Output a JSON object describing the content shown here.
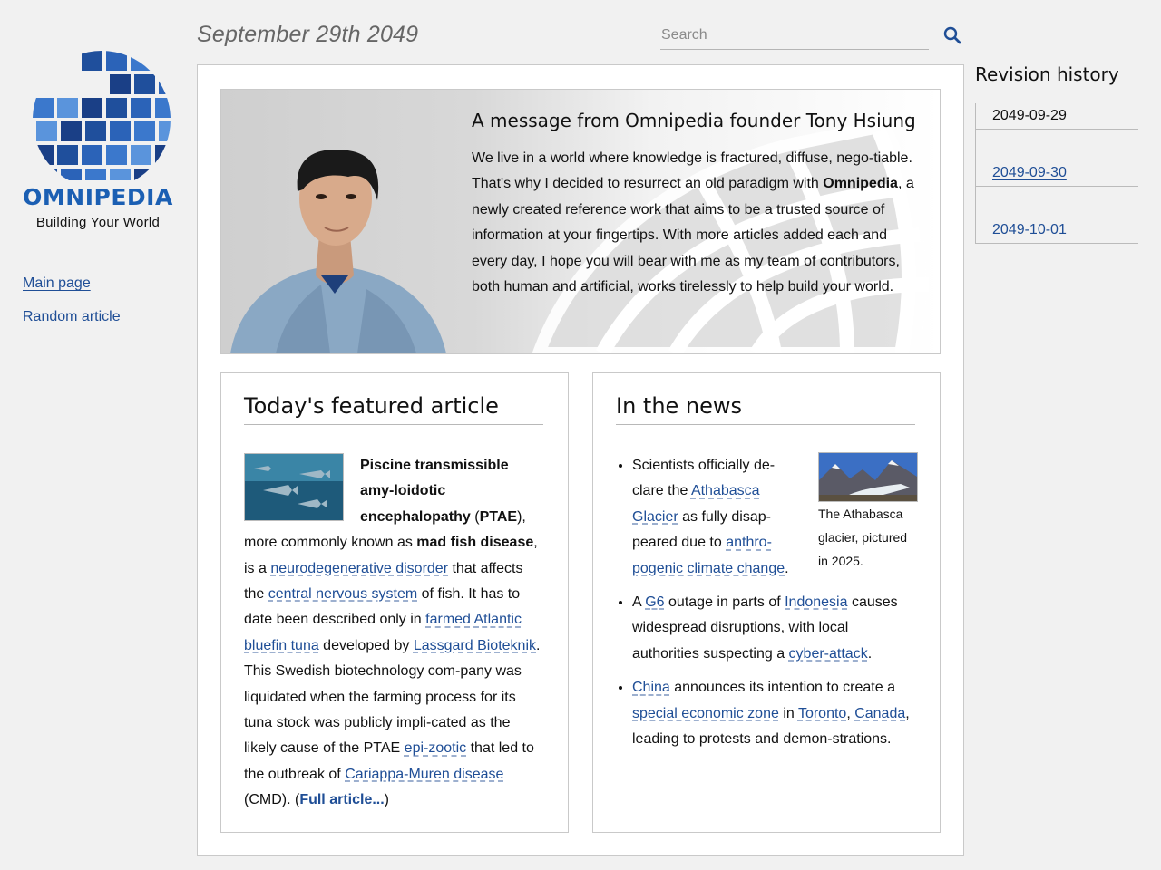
{
  "brand": {
    "name": "OMNIPEDIA",
    "tagline": "Building Your World",
    "accent": "#1b5fb3"
  },
  "nav": {
    "main_page": "Main page",
    "random_article": "Random article"
  },
  "header": {
    "date": "September 29th 2049",
    "search_placeholder": "Search",
    "search_icon": "search-icon"
  },
  "hero": {
    "title": "A message from Omnipedia founder Tony Hsiung",
    "p1": "We live in a world where knowledge is fractured, diffuse, nego-tiable. That's why I decided to resurrect an old paradigm with ",
    "bold": "Omnipedia",
    "p2": ", a newly created reference work that aims to be a trusted source of information at your fingertips. With more articles added each and every day, I hope you will bear with me as my team of contributors, both human and artificial, works tirelessly to help build your world."
  },
  "featured": {
    "heading": "Today's featured article",
    "t1": "Piscine transmissible amy-loidotic encephalopathy",
    "t2": " (",
    "t3": "PTAE",
    "t4": "), more commonly known as ",
    "t5": "mad fish disease",
    "t6": ", is a ",
    "l1": "neurodegenerative disorder",
    "t7": " that affects the ",
    "l2": "central nervous system",
    "t8": " of fish. It has to date been described only in ",
    "l3": "farmed",
    "t9": " ",
    "l4": "Atlantic bluefin tuna",
    "t10": " developed by ",
    "l5": "Lassgard Bioteknik",
    "t11": ". This Swedish biotechnology com-pany was liquidated when the farming process for its tuna stock was publicly impli-cated as the likely cause of the PTAE ",
    "l6": "epi-zootic",
    "t12": " that led to the outbreak of ",
    "l7": "Cariappa-Muren disease",
    "t13": " (CMD). (",
    "full": "Full article...",
    "t14": ")"
  },
  "news": {
    "heading": "In the news",
    "caption": "The Athabasca glacier, pictured in 2025.",
    "i1": {
      "a": "Scientists officially de-clare the ",
      "l1": "Athabasca Glacier",
      "b": " as fully disap-peared due to ",
      "l2": "anthro-pogenic climate change",
      "c": "."
    },
    "i2": {
      "a": "A ",
      "l1": "G6",
      "b": " outage in parts of ",
      "l2": "Indonesia",
      "c": " causes widespread disruptions, with local authorities suspecting a ",
      "l3": "cyber-attack",
      "d": "."
    },
    "i3": {
      "l1": "China",
      "a": " announces its intention to create a ",
      "l2": "special economic zone",
      "b": " in ",
      "l3": "Toronto",
      "c": ", ",
      "l4": "Canada",
      "d": ", leading to protests and demon-strations."
    }
  },
  "revisions": {
    "heading": "Revision history",
    "items": [
      "2049-09-29",
      "2049-09-30",
      "2049-10-01"
    ]
  }
}
